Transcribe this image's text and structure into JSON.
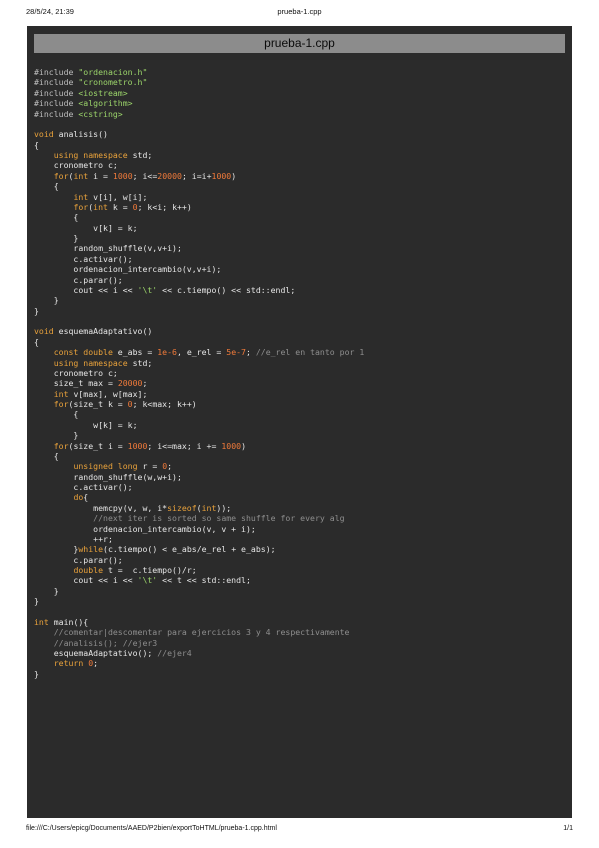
{
  "print_header": {
    "datetime": "28/5/24, 21:39",
    "title": "prueba-1.cpp"
  },
  "code_view": {
    "filename": "prueba-1.cpp",
    "lines": [
      [
        [
          "preproc",
          "#include "
        ],
        [
          "string",
          "\"ordenacion.h\""
        ]
      ],
      [
        [
          "preproc",
          "#include "
        ],
        [
          "string",
          "\"cronometro.h\""
        ]
      ],
      [
        [
          "preproc",
          "#include "
        ],
        [
          "string",
          "<iostream>"
        ]
      ],
      [
        [
          "preproc",
          "#include "
        ],
        [
          "string",
          "<algorithm>"
        ]
      ],
      [
        [
          "preproc",
          "#include "
        ],
        [
          "string",
          "<cstring>"
        ]
      ],
      [],
      [
        [
          "keyword",
          "void"
        ],
        [
          "text",
          " analisis()"
        ]
      ],
      [
        [
          "text",
          "{"
        ]
      ],
      [
        [
          "text",
          "    "
        ],
        [
          "keyword",
          "using namespace"
        ],
        [
          "text",
          " std;"
        ]
      ],
      [
        [
          "text",
          "    cronometro c;"
        ]
      ],
      [
        [
          "text",
          "    "
        ],
        [
          "keyword",
          "for"
        ],
        [
          "text",
          "("
        ],
        [
          "keyword",
          "int"
        ],
        [
          "text",
          " i = "
        ],
        [
          "number",
          "1000"
        ],
        [
          "text",
          "; i<="
        ],
        [
          "number",
          "20000"
        ],
        [
          "text",
          "; i=i+"
        ],
        [
          "number",
          "1000"
        ],
        [
          "text",
          ")"
        ]
      ],
      [
        [
          "text",
          "    {"
        ]
      ],
      [
        [
          "text",
          "        "
        ],
        [
          "keyword",
          "int"
        ],
        [
          "text",
          " v[i], w[i];"
        ]
      ],
      [
        [
          "text",
          "        "
        ],
        [
          "keyword",
          "for"
        ],
        [
          "text",
          "("
        ],
        [
          "keyword",
          "int"
        ],
        [
          "text",
          " k = "
        ],
        [
          "number",
          "0"
        ],
        [
          "text",
          "; k<i; k++)"
        ]
      ],
      [
        [
          "text",
          "        {"
        ]
      ],
      [
        [
          "text",
          "            v[k] = k;"
        ]
      ],
      [
        [
          "text",
          "        }"
        ]
      ],
      [
        [
          "text",
          "        random_shuffle(v,v+i);"
        ]
      ],
      [
        [
          "text",
          "        c.activar();"
        ]
      ],
      [
        [
          "text",
          "        ordenacion_intercambio(v,v+i);"
        ]
      ],
      [
        [
          "text",
          "        c.parar();"
        ]
      ],
      [
        [
          "text",
          "        cout << i << "
        ],
        [
          "string",
          "'\\t'"
        ],
        [
          "text",
          " << c.tiempo() << std::endl;"
        ]
      ],
      [
        [
          "text",
          "    }"
        ]
      ],
      [
        [
          "text",
          "}"
        ]
      ],
      [],
      [
        [
          "keyword",
          "void"
        ],
        [
          "text",
          " esquemaAdaptativo()"
        ]
      ],
      [
        [
          "text",
          "{"
        ]
      ],
      [
        [
          "text",
          "    "
        ],
        [
          "keyword",
          "const double"
        ],
        [
          "text",
          " e_abs = "
        ],
        [
          "number",
          "1e-6"
        ],
        [
          "text",
          ", e_rel = "
        ],
        [
          "number",
          "5e-7"
        ],
        [
          "text",
          "; "
        ],
        [
          "comment",
          "//e_rel en tanto por 1"
        ]
      ],
      [
        [
          "text",
          "    "
        ],
        [
          "keyword",
          "using namespace"
        ],
        [
          "text",
          " std;"
        ]
      ],
      [
        [
          "text",
          "    cronometro c;"
        ]
      ],
      [
        [
          "text",
          "    size_t max = "
        ],
        [
          "number",
          "20000"
        ],
        [
          "text",
          ";"
        ]
      ],
      [
        [
          "text",
          "    "
        ],
        [
          "keyword",
          "int"
        ],
        [
          "text",
          " v[max], w[max];"
        ]
      ],
      [
        [
          "text",
          "    "
        ],
        [
          "keyword",
          "for"
        ],
        [
          "text",
          "(size_t k = "
        ],
        [
          "number",
          "0"
        ],
        [
          "text",
          "; k<max; k++)"
        ]
      ],
      [
        [
          "text",
          "        {"
        ]
      ],
      [
        [
          "text",
          "            w[k] = k;"
        ]
      ],
      [
        [
          "text",
          "        }"
        ]
      ],
      [
        [
          "text",
          "    "
        ],
        [
          "keyword",
          "for"
        ],
        [
          "text",
          "(size_t i = "
        ],
        [
          "number",
          "1000"
        ],
        [
          "text",
          "; i<=max; i += "
        ],
        [
          "number",
          "1000"
        ],
        [
          "text",
          ")"
        ]
      ],
      [
        [
          "text",
          "    {"
        ]
      ],
      [
        [
          "text",
          "        "
        ],
        [
          "keyword",
          "unsigned long"
        ],
        [
          "text",
          " r = "
        ],
        [
          "number",
          "0"
        ],
        [
          "text",
          ";"
        ]
      ],
      [
        [
          "text",
          "        random_shuffle(w,w+i);"
        ]
      ],
      [
        [
          "text",
          "        c.activar();"
        ]
      ],
      [
        [
          "text",
          "        "
        ],
        [
          "keyword",
          "do"
        ],
        [
          "text",
          "{"
        ]
      ],
      [
        [
          "text",
          "            memcpy(v, w, i*"
        ],
        [
          "keyword",
          "sizeof"
        ],
        [
          "text",
          "("
        ],
        [
          "keyword",
          "int"
        ],
        [
          "text",
          "));"
        ]
      ],
      [
        [
          "text",
          "            "
        ],
        [
          "comment",
          "//next iter is sorted so same shuffle for every alg"
        ]
      ],
      [
        [
          "text",
          "            ordenacion_intercambio(v, v + i);"
        ]
      ],
      [
        [
          "text",
          "            ++r;"
        ]
      ],
      [
        [
          "text",
          "        }"
        ],
        [
          "keyword",
          "while"
        ],
        [
          "text",
          "(c.tiempo() < e_abs/e_rel + e_abs);"
        ]
      ],
      [
        [
          "text",
          "        c.parar();"
        ]
      ],
      [
        [
          "text",
          "        "
        ],
        [
          "keyword",
          "double"
        ],
        [
          "text",
          " t =  c.tiempo()/r;"
        ]
      ],
      [
        [
          "text",
          "        cout << i << "
        ],
        [
          "string",
          "'\\t'"
        ],
        [
          "text",
          " << t << std::endl;"
        ]
      ],
      [
        [
          "text",
          "    }"
        ]
      ],
      [
        [
          "text",
          "}"
        ]
      ],
      [],
      [
        [
          "keyword",
          "int"
        ],
        [
          "text",
          " main(){"
        ]
      ],
      [
        [
          "text",
          "    "
        ],
        [
          "comment",
          "//comentar|descomentar para ejercicios 3 y 4 respectivamente"
        ]
      ],
      [
        [
          "text",
          "    "
        ],
        [
          "comment",
          "//analisis(); //ejer3"
        ]
      ],
      [
        [
          "text",
          "    esquemaAdaptativo(); "
        ],
        [
          "comment",
          "//ejer4"
        ]
      ],
      [
        [
          "text",
          "    "
        ],
        [
          "keyword",
          "return"
        ],
        [
          "text",
          " "
        ],
        [
          "number",
          "0"
        ],
        [
          "text",
          ";"
        ]
      ],
      [
        [
          "text",
          "}"
        ]
      ]
    ]
  },
  "print_footer": {
    "file_path": "file:///C:/Users/epicg/Documents/AAED/P2bien/exportToHTML/prueba-1.cpp.html",
    "page_count": "1/1"
  }
}
